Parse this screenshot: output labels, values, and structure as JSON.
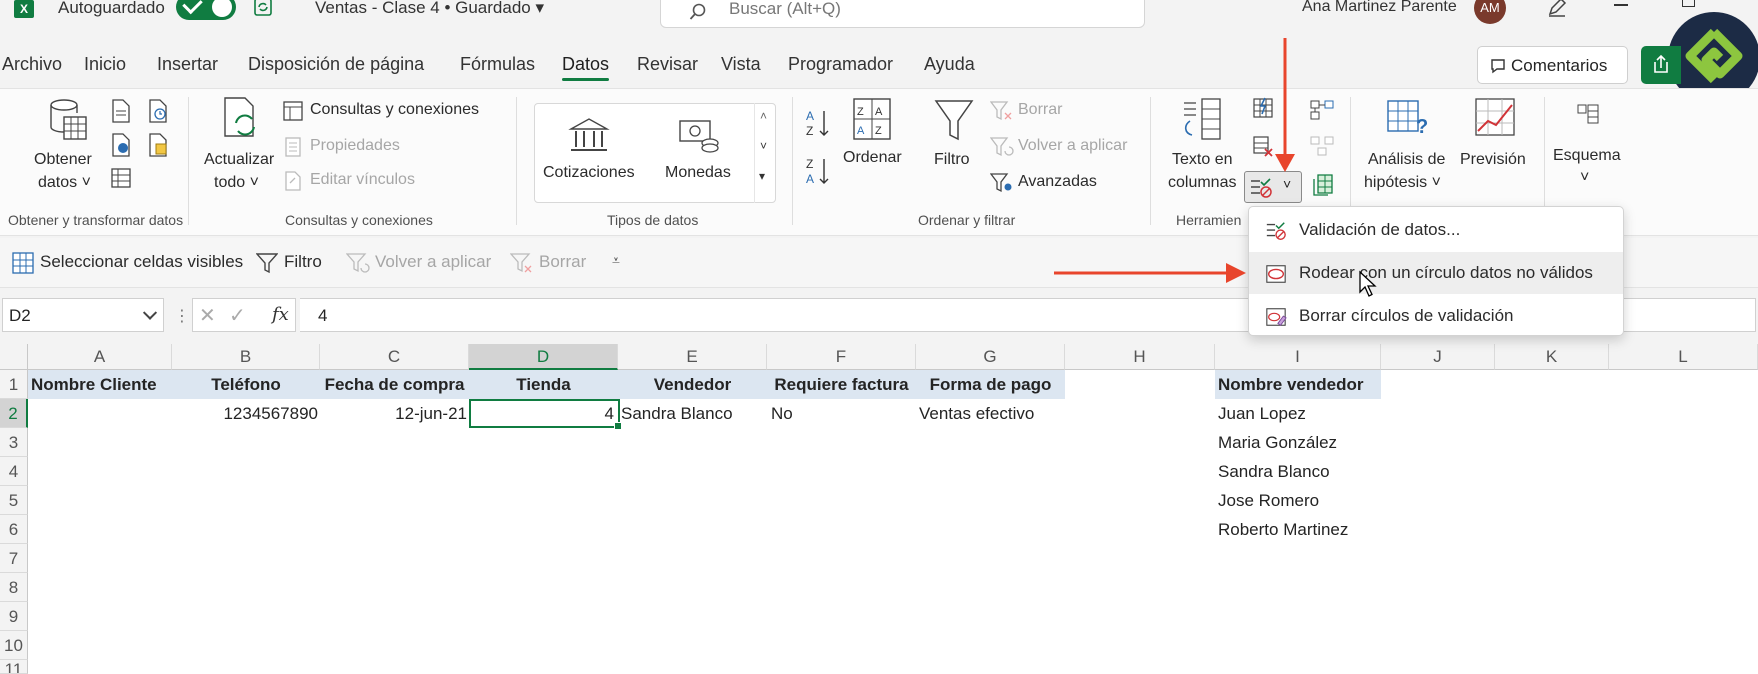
{
  "titlebar": {
    "autosave_label": "Autoguardado",
    "document_name": "Ventas - Clase 4 • Guardado",
    "search_placeholder": "Buscar (Alt+Q)",
    "user_name": "Ana Martinez Parente",
    "user_initials": "AM"
  },
  "menu": {
    "tabs": [
      "Archivo",
      "Inicio",
      "Insertar",
      "Disposición de página",
      "Fórmulas",
      "Datos",
      "Revisar",
      "Vista",
      "Programador",
      "Ayuda"
    ],
    "active_tab": "Datos",
    "comments_label": "Comentarios"
  },
  "ribbon": {
    "get_data": {
      "line1": "Obtener",
      "line2": "datos"
    },
    "group1_label": "Obtener y transformar datos",
    "refresh": {
      "line1": "Actualizar",
      "line2": "todo"
    },
    "queries_connections": "Consultas y conexiones",
    "properties": "Propiedades",
    "edit_links": "Editar vínculos",
    "group2_label": "Consultas y conexiones",
    "stocks": "Cotizaciones",
    "currencies": "Monedas",
    "group3_label": "Tipos de datos",
    "sort": "Ordenar",
    "filter": "Filtro",
    "clear": "Borrar",
    "reapply": "Volver a aplicar",
    "advanced": "Avanzadas",
    "group4_label": "Ordenar y filtrar",
    "text_to_columns": {
      "line1": "Texto en",
      "line2": "columnas"
    },
    "group5_label": "Herramien",
    "what_if": {
      "line1": "Análisis de",
      "line2": "hipótesis"
    },
    "forecast": "Previsión",
    "outline": "Esquema"
  },
  "quick_access": {
    "select_visible": "Seleccionar celdas visibles",
    "filter": "Filtro",
    "reapply": "Volver a aplicar",
    "clear": "Borrar"
  },
  "formula_bar": {
    "name_box": "D2",
    "formula": "4",
    "fx": "fx"
  },
  "sheet": {
    "columns": [
      "A",
      "B",
      "C",
      "D",
      "E",
      "F",
      "G",
      "H",
      "I",
      "J",
      "K",
      "L"
    ],
    "selected_column": "D",
    "rows": [
      "1",
      "2",
      "3",
      "4",
      "5",
      "6",
      "7",
      "8",
      "9",
      "10",
      "11"
    ],
    "headers": {
      "A": "Nombre Cliente",
      "B": "Teléfono",
      "C": "Fecha de compra",
      "D": "Tienda",
      "E": "Vendedor",
      "F": "Requiere factura",
      "G": "Forma de pago",
      "I": "Nombre vendedor"
    },
    "row2": {
      "B": "1234567890",
      "C": "12-jun-21",
      "D": "4",
      "E": "Sandra Blanco",
      "F": "No",
      "G": "Ventas efectivo"
    },
    "sellers": [
      "Juan Lopez",
      "Maria González",
      "Sandra Blanco",
      "Jose Romero",
      "Roberto Martinez"
    ],
    "header_fill_color": "#dce6f1",
    "active_cell": "D2"
  },
  "dropdown": {
    "items": [
      "Validación de datos...",
      "Rodear con un círculo datos no válidos",
      "Borrar círculos de validación"
    ],
    "hovered_index": 1
  },
  "colors": {
    "accent": "#107c41",
    "annotation_arrow": "#e8452c"
  }
}
